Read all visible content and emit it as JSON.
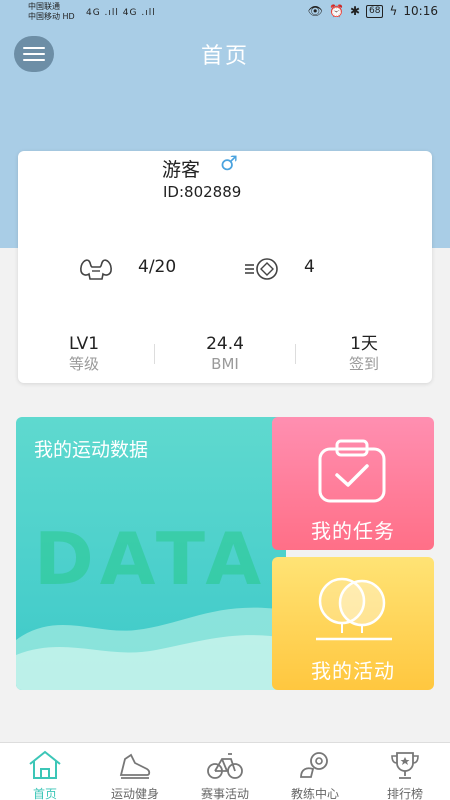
{
  "status_bar": {
    "carrier_1": "中国联通",
    "carrier_2": "中国移动 HD",
    "signal": "4G .ıll 4G .ıll",
    "battery": "68",
    "time": "10:16"
  },
  "header": {
    "title": "首页",
    "menu_icon": "hamburger-icon"
  },
  "profile": {
    "username": "游客",
    "gender_symbol": "♂",
    "user_id": "ID:802889",
    "stats": [
      {
        "icon": "muscle-icon",
        "value": "4/20"
      },
      {
        "icon": "coin-icon",
        "value": "4"
      }
    ],
    "mini_stats": [
      {
        "value": "LV1",
        "label": "等级"
      },
      {
        "value": "24.4",
        "label": "BMI"
      },
      {
        "value": "1天",
        "label": "签到"
      }
    ]
  },
  "tiles": {
    "data": {
      "title": "我的运动数据",
      "watermark": "DATA"
    },
    "task": {
      "label": "我的任务",
      "icon": "checklist-icon"
    },
    "activity": {
      "label": "我的活动",
      "icon": "balloons-icon"
    }
  },
  "bottom_nav": {
    "active": 0,
    "items": [
      {
        "label": "首页",
        "icon": "home-icon"
      },
      {
        "label": "运动健身",
        "icon": "shoe-icon"
      },
      {
        "label": "赛事活动",
        "icon": "bicycle-icon"
      },
      {
        "label": "教练中心",
        "icon": "coach-icon"
      },
      {
        "label": "排行榜",
        "icon": "trophy-icon"
      }
    ]
  },
  "colors": {
    "header_bg": "#a9cde6",
    "accent": "#3cc6b7",
    "task_pink": "#ff7a95",
    "activity_yellow": "#ffd24f"
  }
}
